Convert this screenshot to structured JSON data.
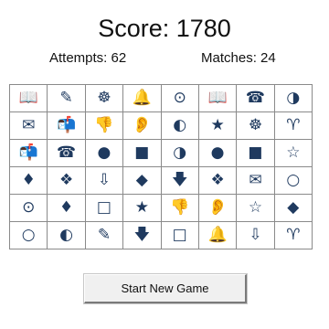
{
  "header": {
    "score": "Score: 1780",
    "attempts": "Attempts: 62",
    "matches": "Matches: 24"
  },
  "board": {
    "rows": [
      [
        {
          "glyph": "📖",
          "icon": "open-book-icon"
        },
        {
          "glyph": "✎",
          "icon": "pencil-icon"
        },
        {
          "glyph": "☸",
          "icon": "ship-wheel-icon"
        },
        {
          "glyph": "🔔",
          "icon": "bell-icon"
        },
        {
          "glyph": "⊙",
          "icon": "circled-dot-icon"
        },
        {
          "glyph": "📖",
          "icon": "open-book-icon"
        },
        {
          "glyph": "☎",
          "icon": "telephone-icon"
        },
        {
          "glyph": "◑",
          "icon": "half-moon-icon"
        }
      ],
      [
        {
          "glyph": "✉",
          "icon": "envelope-icon"
        },
        {
          "glyph": "📬",
          "icon": "mailbox-icon"
        },
        {
          "glyph": "👎",
          "icon": "thumbs-down-icon"
        },
        {
          "glyph": "👂",
          "icon": "ear-icon"
        },
        {
          "glyph": "◐",
          "icon": "pacman-icon"
        },
        {
          "glyph": "★",
          "icon": "star-icon"
        },
        {
          "glyph": "☸",
          "icon": "ship-wheel-icon"
        },
        {
          "glyph": "♈",
          "icon": "aries-icon"
        }
      ],
      [
        {
          "glyph": "📬",
          "icon": "mailbox-icon"
        },
        {
          "glyph": "☎",
          "icon": "telephone-icon"
        },
        {
          "glyph": "●",
          "icon": "filled-circle-icon"
        },
        {
          "glyph": "■",
          "icon": "filled-square-icon"
        },
        {
          "glyph": "◑",
          "icon": "half-moon-icon"
        },
        {
          "glyph": "●",
          "icon": "filled-circle-icon"
        },
        {
          "glyph": "■",
          "icon": "filled-square-icon"
        },
        {
          "glyph": "☆",
          "icon": "outline-star-icon"
        }
      ],
      [
        {
          "glyph": "♦",
          "icon": "small-diamond-icon"
        },
        {
          "glyph": "❖",
          "icon": "four-diamonds-icon"
        },
        {
          "glyph": "⇩",
          "icon": "hollow-down-arrow-icon"
        },
        {
          "glyph": "◆",
          "icon": "diamond-icon"
        },
        {
          "glyph": "🡇",
          "icon": "down-arrow-icon"
        },
        {
          "glyph": "❖",
          "icon": "four-diamonds-icon"
        },
        {
          "glyph": "✉",
          "icon": "envelope-icon"
        },
        {
          "glyph": "○",
          "icon": "ring-icon"
        }
      ],
      [
        {
          "glyph": "⊙",
          "icon": "circled-dot-icon"
        },
        {
          "glyph": "♦",
          "icon": "small-diamond-icon"
        },
        {
          "glyph": "□",
          "icon": "hollow-square-icon"
        },
        {
          "glyph": "★",
          "icon": "star-icon"
        },
        {
          "glyph": "👎",
          "icon": "thumbs-down-icon"
        },
        {
          "glyph": "👂",
          "icon": "ear-icon"
        },
        {
          "glyph": "☆",
          "icon": "outline-star-icon"
        },
        {
          "glyph": "◆",
          "icon": "diamond-icon"
        }
      ],
      [
        {
          "glyph": "○",
          "icon": "ring-icon"
        },
        {
          "glyph": "◐",
          "icon": "pacman-icon"
        },
        {
          "glyph": "✎",
          "icon": "pencil-icon"
        },
        {
          "glyph": "🡇",
          "icon": "down-arrow-icon"
        },
        {
          "glyph": "□",
          "icon": "hollow-square-icon"
        },
        {
          "glyph": "🔔",
          "icon": "bell-icon"
        },
        {
          "glyph": "⇩",
          "icon": "hollow-down-arrow-icon"
        },
        {
          "glyph": "♈",
          "icon": "aries-icon"
        }
      ]
    ]
  },
  "footer": {
    "new_game_label": "Start New Game"
  },
  "colors": {
    "symbol": "#1f3a5f",
    "grid_line": "#8a8a8a"
  }
}
